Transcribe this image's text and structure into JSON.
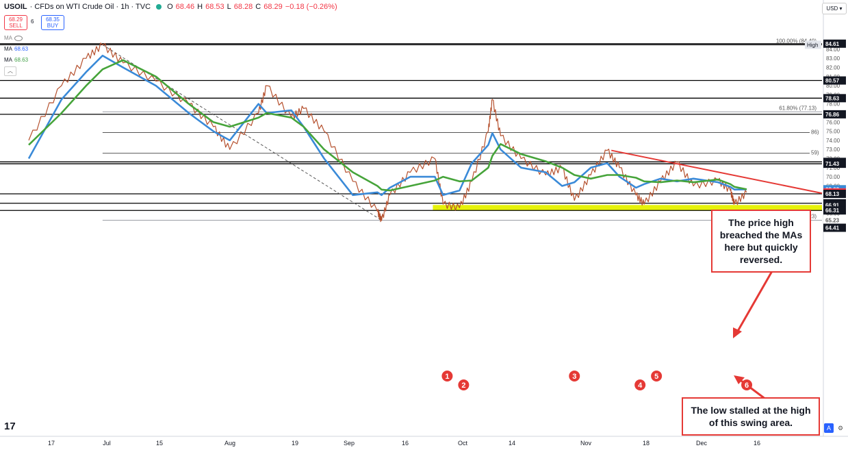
{
  "header": {
    "symbol": "USOIL",
    "description": "· CFDs on WTI Crude Oil · 1h · TVC",
    "o_label": "O",
    "o_value": "68.46",
    "h_label": "H",
    "h_value": "68.53",
    "l_label": "L",
    "l_value": "68.28",
    "c_label": "C",
    "c_value": "68.29",
    "change": "−0.18 (−0.26%)",
    "sell_price": "68.29",
    "sell_label": "SELL",
    "spread": "6",
    "buy_price": "68.35",
    "buy_label": "BUY"
  },
  "indicators": [
    {
      "name": "MA",
      "value": ""
    },
    {
      "name": "MA",
      "value": "68.63"
    },
    {
      "name": "MA",
      "value": "68.63"
    }
  ],
  "currency": "USD ▾",
  "colors": {
    "up": "#26a69a",
    "down": "#b5502d",
    "ma_fast": "#3a8ad8",
    "ma_slow": "#46a43a",
    "zone": "#e6f20a",
    "trendline": "#e53935",
    "badge": "#e53935",
    "text": "#131722"
  },
  "chart_data": {
    "type": "line",
    "title": "USOIL · CFDs on WTI Crude Oil · 1h · TVC",
    "xlabel": "",
    "ylabel": "",
    "ylim": [
      64.0,
      85.3
    ],
    "x_ticks": [
      "17",
      "Jul",
      "15",
      "Aug",
      "19",
      "Sep",
      "16",
      "Oct",
      "14",
      "Nov",
      "18",
      "Dec",
      "16"
    ],
    "y_ticks": [
      65.0,
      66.0,
      67.0,
      68.0,
      69.0,
      70.0,
      71.0,
      72.0,
      73.0,
      74.0,
      75.0,
      76.0,
      77.0,
      78.0,
      79.0,
      80.0,
      81.0,
      82.0,
      83.0,
      84.0
    ],
    "price_path": {
      "x": [
        "17 Jun",
        "25 Jun",
        "1 Jul",
        "5 Jul",
        "10 Jul",
        "18 Jul",
        "26 Jul",
        "1 Aug",
        "5 Aug",
        "12 Aug",
        "14 Aug",
        "20 Aug",
        "23 Aug",
        "28 Aug",
        "4 Sep",
        "10 Sep",
        "11 Sep",
        "13 Sep",
        "18 Sep",
        "24 Sep",
        "26 Sep",
        "30 Sep",
        "3 Oct",
        "7 Oct",
        "8 Oct",
        "10 Oct",
        "15 Oct",
        "21 Oct",
        "25 Oct",
        "28 Oct",
        "1 Nov",
        "5 Nov",
        "8 Nov",
        "12 Nov",
        "14 Nov",
        "18 Nov",
        "22 Nov",
        "26 Nov",
        "2 Dec",
        "5 Dec",
        "6 Dec",
        "9 Dec"
      ],
      "y": [
        74.0,
        80.0,
        83.0,
        84.49,
        82.5,
        80.5,
        78.0,
        75.5,
        73.0,
        77.0,
        80.0,
        76.5,
        77.5,
        75.0,
        69.5,
        66.2,
        65.2,
        68.0,
        70.5,
        72.0,
        67.0,
        66.6,
        69.5,
        75.0,
        78.5,
        74.5,
        72.0,
        70.2,
        71.0,
        67.4,
        70.2,
        72.9,
        71.0,
        68.0,
        67.0,
        69.5,
        71.6,
        69.0,
        69.6,
        68.5,
        67.0,
        68.29
      ]
    },
    "series": [
      {
        "name": "MA",
        "values": [
          72.0,
          78.5,
          81.5,
          83.3,
          82.0,
          80.0,
          77.0,
          75.0,
          74.0,
          78.0,
          77.0,
          77.3,
          75.5,
          72.0,
          68.0,
          68.3,
          68.0,
          68.8,
          70.0,
          70.0,
          68.0,
          68.5,
          71.5,
          73.5,
          74.8,
          73.0,
          71.0,
          70.5,
          69.0,
          69.4,
          71.0,
          71.5,
          70.0,
          68.8,
          69.2,
          69.8,
          69.5,
          69.8,
          69.4,
          68.9,
          68.6,
          68.63
        ]
      },
      {
        "name": "MA",
        "values": [
          73.5,
          77.0,
          80.0,
          81.8,
          82.8,
          81.0,
          78.0,
          76.0,
          75.5,
          76.5,
          77.0,
          76.5,
          75.5,
          73.0,
          70.5,
          69.0,
          68.6,
          68.5,
          69.0,
          69.6,
          70.0,
          69.5,
          69.6,
          71.0,
          72.3,
          73.6,
          72.5,
          71.7,
          71.0,
          70.2,
          69.8,
          70.2,
          70.2,
          69.9,
          69.5,
          69.4,
          69.6,
          69.4,
          69.7,
          69.2,
          68.9,
          68.63
        ]
      }
    ],
    "horizontal_levels": [
      84.61,
      84.49,
      80.57,
      78.63,
      76.86,
      71.43,
      71.44,
      71.64,
      68.13,
      67.1,
      66.31
    ],
    "price_scale_labels": [
      {
        "value": 84.61,
        "text": "84.61"
      },
      {
        "value": 80.57,
        "text": "80.57"
      },
      {
        "value": 78.63,
        "text": "78.63"
      },
      {
        "value": 76.86,
        "text": "76.86"
      },
      {
        "value": 71.64,
        "text": "71.64"
      },
      {
        "value": 71.44,
        "text": "71.44"
      },
      {
        "value": 71.43,
        "text": "71.43"
      },
      {
        "value": 68.63,
        "text": "68.63"
      },
      {
        "value": 68.63,
        "text": "68.63"
      },
      {
        "value": 68.29,
        "text": "68.29"
      },
      {
        "value": 68.13,
        "text": "68.13"
      },
      {
        "value": 67.1,
        "text": "67.10"
      },
      {
        "value": 66.91,
        "text": "66.91"
      },
      {
        "value": 66.31,
        "text": "66.31"
      },
      {
        "value": 65.23,
        "text": "65.23"
      },
      {
        "value": 64.41,
        "text": "64.41"
      }
    ],
    "high_label": "High",
    "fibonacci": [
      {
        "text": "100.00% (84.49)",
        "value": 84.49
      },
      {
        "text": "61.80% (77.13)",
        "value": 77.13
      },
      {
        "text": "0.00% (65.23)",
        "value": 65.23
      }
    ],
    "fib_cut_labels": [
      {
        "text": "86)",
        "value": 74.86
      },
      {
        "text": "59)",
        "value": 72.59
      }
    ],
    "support_zone": [
      66.31,
      66.91
    ],
    "trendline": {
      "start": [
        "6 Nov",
        72.9
      ],
      "end": [
        "16 Dec",
        68.2
      ]
    },
    "old_trendline": {
      "start": [
        "5 Jul",
        84.49
      ],
      "end": [
        "11 Sep",
        65.23
      ]
    },
    "swing_lows": [
      {
        "label": "1",
        "date": "27 Sep"
      },
      {
        "label": "2",
        "date": "1 Oct"
      },
      {
        "label": "3",
        "date": "28 Oct"
      },
      {
        "label": "4",
        "date": "13 Nov"
      },
      {
        "label": "5",
        "date": "17 Nov"
      },
      {
        "label": "6",
        "date": "9 Dec"
      }
    ]
  },
  "annotations": {
    "callout_top": "The price high breached the MAs here but quickly reversed.",
    "callout_bottom": "The low stalled at the high of this swing area."
  },
  "bottom_controls": {
    "auto_label": "A",
    "settings_label": "⚙"
  }
}
